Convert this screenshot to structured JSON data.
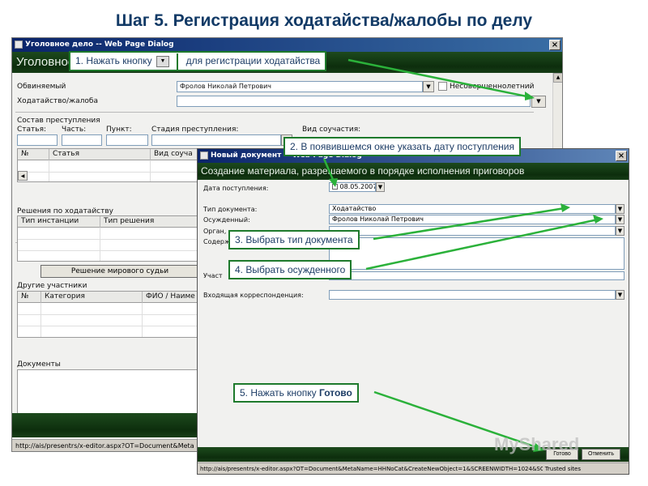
{
  "slide": {
    "title": "Шаг 5. Регистрация ходатайства/жалобы по делу"
  },
  "window1": {
    "title": "Уголовное дело -- Web Page Dialog",
    "header": "Уголовное дело",
    "labels": {
      "accused": "Обвиняемый",
      "petition": "Ходатайство/жалоба",
      "minor": "Несовершеннолетний",
      "crime_composition": "Состав преступления",
      "article": "Статья:",
      "part": "Часть:",
      "point": "Пункт:",
      "stage": "Стадия преступления:",
      "complicity": "Вид соучастия:",
      "decisions": "Решения по ходатайству",
      "magistrate_button": "Решение мирового судьи",
      "other_participants": "Другие участники",
      "documents": "Документы"
    },
    "accused_value": "Фролов Николай Петрович",
    "crime_table": {
      "columns": [
        "№",
        "Статья",
        "Вид соуча"
      ]
    },
    "decisions_table": {
      "columns": [
        "Тип инстанции",
        "Тип решения"
      ]
    },
    "participants_table": {
      "columns": [
        "№",
        "Категория",
        "ФИО / Наиме"
      ]
    },
    "status_url": "http://ais/presentrs/x-editor.aspx?OT=Document&Meta"
  },
  "window2": {
    "title": "Новый документ -- Web Page Dialog",
    "header": "Создание материала, разрешаемого в порядке исполнения приговоров",
    "labels": {
      "date": "Дата поступления:",
      "doc_type": "Тип документа:",
      "convicted": "Осужденный:",
      "organ": "Орган,",
      "content": "Содерж",
      "participant": "Участ",
      "incoming": "Входящая корреспонденция:"
    },
    "date_value": "08.05.2007",
    "doc_type_value": "Ходатайство",
    "convicted_value": "Фролов Николай Петрович",
    "done_button": "Готово",
    "cancel_button": "Отменить",
    "status_url": "http://ais/presentrs/x-editor.aspx?OT=Document&MetaName=HHNoCat&CreateNewObject=1&SCREENWIDTH=1024&SCl",
    "trusted": "Trusted sites"
  },
  "callouts": {
    "c1_prefix": "1. Нажать кнопку",
    "c1_suffix": "для регистрации ходатайства",
    "c2": "2. В появившемся окне указать дату поступления",
    "c3": "3. Выбрать тип документа",
    "c4": "4. Выбрать осужденного",
    "c5_prefix": "5. Нажать кнопку",
    "c5_bold": "Готово"
  },
  "watermark": "MyShared",
  "colors": {
    "callout_border": "#1e7a2c",
    "title": "#123a66",
    "header_green": "#163c16"
  }
}
